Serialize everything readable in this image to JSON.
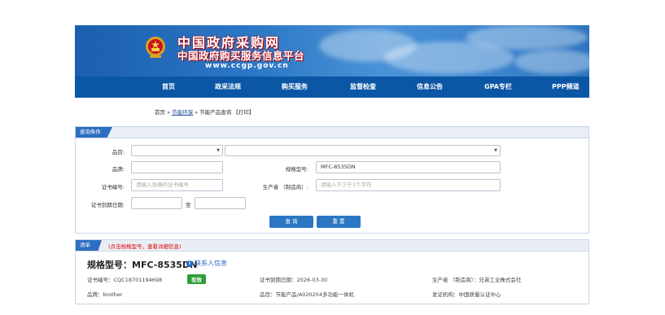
{
  "banner": {
    "title": "中国政府采购网",
    "subtitle": "中国政府购买服务信息平台",
    "url": "www.ccgp.gov.cn"
  },
  "nav": {
    "items": [
      "首页",
      "政采法规",
      "购买服务",
      "监督检查",
      "信息公告",
      "GPA专栏",
      "PPP频道"
    ]
  },
  "breadcrumb": {
    "home": "首页",
    "sep1": " » ",
    "section": "节能环保",
    "sep2": " » ",
    "page": "节能产品查询",
    "print": "【打印】"
  },
  "query": {
    "header": "查询条件",
    "category_label": "品目:",
    "brand_label": "品牌:",
    "model_label": "规格型号:",
    "model_value": "MFC-8535DN",
    "cert_label": "证书编号:",
    "cert_placeholder": "请输入准确的证书编号",
    "maker_label": "生产者 （制造商）:",
    "maker_placeholder": "请输入不少于3个字符",
    "expiry_label": "证书到期日期:",
    "to_label": "至",
    "search_button": "查 询",
    "reset_button": "重 置"
  },
  "results": {
    "header": "清单",
    "hint": "(点击规格型号，查看详细信息)",
    "model_title": "规格型号：MFC-8535DN",
    "contact": "联系人信息",
    "cert_no": "证书编号：CQC18701194698",
    "status": "有效",
    "expiry": "证书到期日期：2026-03-30",
    "maker": "生产者 （制造商）：兄弟工业株式会社",
    "brand": "品牌：brother",
    "category": "品目：节能产品/A020204多功能一体机",
    "issuer": "发证机构：中国质量认证中心"
  }
}
